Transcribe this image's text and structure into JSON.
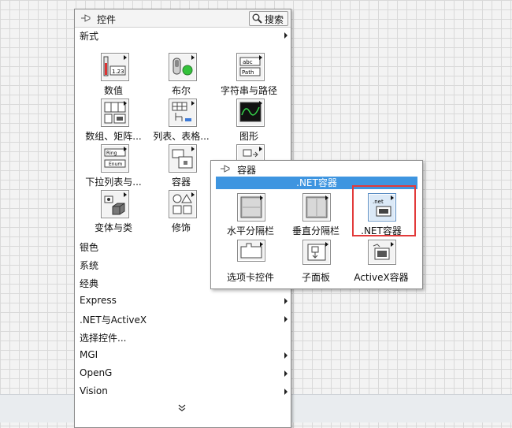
{
  "palette": {
    "title": "控件",
    "search_label": "搜索",
    "section_label": "新式",
    "icons": [
      {
        "label": "数值",
        "icon": "numeric-icon"
      },
      {
        "label": "布尔",
        "icon": "boolean-icon"
      },
      {
        "label": "字符串与路径",
        "icon": "string-path-icon"
      },
      {
        "label": "数组、矩阵...",
        "icon": "array-matrix-icon"
      },
      {
        "label": "列表、表格...",
        "icon": "list-table-icon"
      },
      {
        "label": "图形",
        "icon": "graph-icon"
      },
      {
        "label": "下拉列表与...",
        "icon": "ring-enum-icon"
      },
      {
        "label": "容器",
        "icon": "container-icon"
      },
      {
        "label": "变体与类",
        "icon": "variant-class-icon"
      },
      {
        "label": "修饰",
        "icon": "decorations-icon"
      }
    ],
    "categories": [
      {
        "label": "银色",
        "has_submenu": false
      },
      {
        "label": "系统",
        "has_submenu": false
      },
      {
        "label": "经典",
        "has_submenu": false
      },
      {
        "label": "Express",
        "has_submenu": true
      },
      {
        "label": ".NET与ActiveX",
        "has_submenu": true
      },
      {
        "label": "选择控件...",
        "has_submenu": false
      },
      {
        "label": "MGI",
        "has_submenu": true
      },
      {
        "label": "OpenG",
        "has_submenu": true
      },
      {
        "label": "Vision",
        "has_submenu": true
      }
    ]
  },
  "subpalette": {
    "title": "容器",
    "hover_label": ".NET容器",
    "items": [
      {
        "label": "水平分隔栏",
        "icon": "horizontal-splitter-icon"
      },
      {
        "label": "垂直分隔栏",
        "icon": "vertical-splitter-icon"
      },
      {
        "label": ".NET容器",
        "icon": "dotnet-container-icon"
      },
      {
        "label": "选项卡控件",
        "icon": "tab-control-icon"
      },
      {
        "label": "子面板",
        "icon": "subpanel-icon"
      },
      {
        "label": "ActiveX容器",
        "icon": "activex-container-icon"
      }
    ]
  },
  "icon_glyphs": {
    "icons_1_tile_text": "abc",
    "path_text": "Path",
    "numeric_text": "1.23",
    "ring_text": "Ring",
    "enum_text": "Enum",
    "net_text": ".net"
  }
}
